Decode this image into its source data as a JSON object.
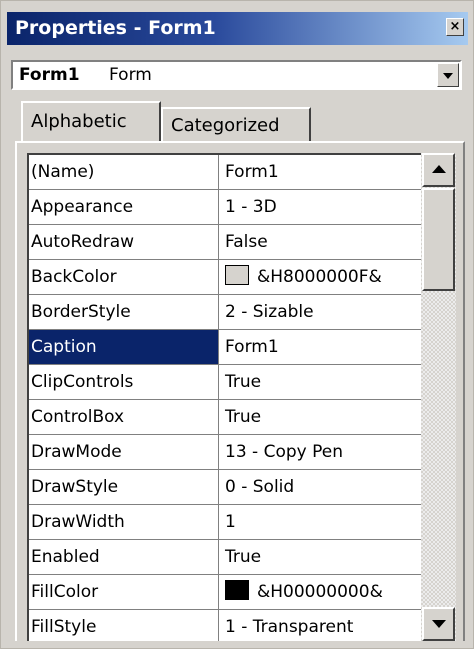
{
  "window": {
    "title": "Properties - Form1",
    "close_glyph": "×"
  },
  "object_selector": {
    "name": "Form1",
    "type": "Form"
  },
  "tabs": [
    {
      "label": "Alphabetic",
      "active": true
    },
    {
      "label": "Categorized",
      "active": false
    }
  ],
  "properties": [
    {
      "name": "(Name)",
      "value": "Form1"
    },
    {
      "name": "Appearance",
      "value": "1 - 3D"
    },
    {
      "name": "AutoRedraw",
      "value": "False"
    },
    {
      "name": "BackColor",
      "value": "&H8000000F&",
      "swatch": "#d6d3ce"
    },
    {
      "name": "BorderStyle",
      "value": "2 - Sizable"
    },
    {
      "name": "Caption",
      "value": "Form1",
      "selected": true
    },
    {
      "name": "ClipControls",
      "value": "True"
    },
    {
      "name": "ControlBox",
      "value": "True"
    },
    {
      "name": "DrawMode",
      "value": "13 - Copy Pen"
    },
    {
      "name": "DrawStyle",
      "value": "0 - Solid"
    },
    {
      "name": "DrawWidth",
      "value": "1"
    },
    {
      "name": "Enabled",
      "value": "True"
    },
    {
      "name": "FillColor",
      "value": "&H00000000&",
      "swatch": "#000000"
    },
    {
      "name": "FillStyle",
      "value": "1 - Transparent"
    }
  ],
  "colors": {
    "selection": "#0a246a",
    "face": "#d6d3ce",
    "titlebar_start": "#0a246a",
    "titlebar_end": "#a6caf0"
  }
}
